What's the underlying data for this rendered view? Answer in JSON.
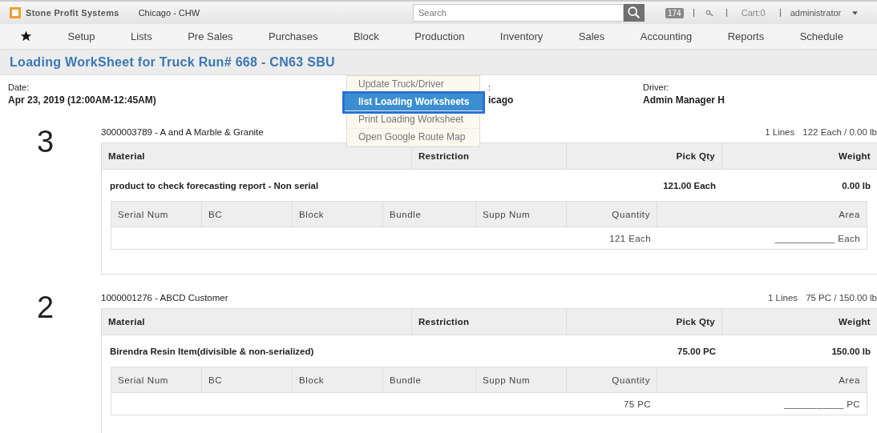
{
  "topbar": {
    "brand": "Stone Profit Systems",
    "location": "Chicago - CHW",
    "search": {
      "placeholder": "Search"
    },
    "notifications": "174",
    "cart": "Cart:0",
    "user": "administrator"
  },
  "nav": [
    "Setup",
    "Lists",
    "Pre Sales",
    "Purchases",
    "Block",
    "Production",
    "Inventory",
    "Sales",
    "Accounting",
    "Reports",
    "Schedule"
  ],
  "page_title": "Loading WorkSheet for Truck Run# 668 - CN63 SBU",
  "info": [
    {
      "label": "Date:",
      "value": "Apr 23, 2019 (12:00AM-12:45AM)"
    },
    {
      "label": ":",
      "value": "icago"
    },
    {
      "label": "Driver:",
      "value": "Admin Manager H"
    }
  ],
  "menu": [
    {
      "label": "Update Truck/Driver",
      "selected": false
    },
    {
      "label": "list Loading Worksheets",
      "selected": true
    },
    {
      "label": "Print Loading Worksheet",
      "selected": false
    },
    {
      "label": "Open Google Route Map",
      "selected": false
    }
  ],
  "stops": [
    {
      "number": "3",
      "customer": "3000003789 - A and A Marble & Granite",
      "lines": "1 Lines",
      "totals": "122 Each / 0.00 lb",
      "columns": [
        "Material",
        "Restriction",
        "Pick Qty",
        "Weight"
      ],
      "material": "product to check forecasting report - Non serial",
      "pick_qty": "121.00 Each",
      "weight": "0.00 lb",
      "detail_columns": [
        "Serial Num",
        "BC",
        "Block",
        "Bundle",
        "Supp Num",
        "Quantity",
        "Area"
      ],
      "quantity": "121 Each",
      "area": "___________ Each"
    },
    {
      "number": "2",
      "customer": "1000001276 - ABCD Customer",
      "lines": "1 Lines",
      "totals": "75 PC / 150.00 lb",
      "columns": [
        "Material",
        "Restriction",
        "Pick Qty",
        "Weight"
      ],
      "material": "Birendra Resin Item(divisible & non-serialized)",
      "pick_qty": "75.00 PC",
      "weight": "150.00 lb",
      "detail_columns": [
        "Serial Num",
        "BC",
        "Block",
        "Bundle",
        "Supp Num",
        "Quantity",
        "Area"
      ],
      "quantity": "75 PC",
      "area": "___________ PC"
    }
  ]
}
